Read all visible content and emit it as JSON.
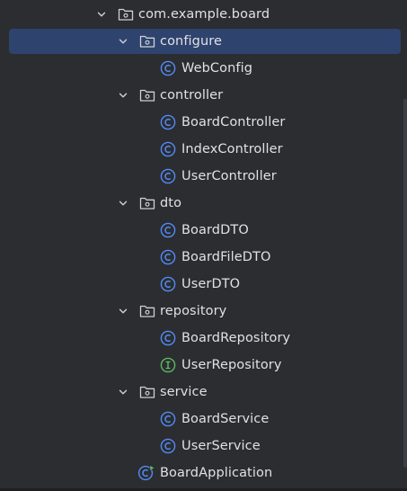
{
  "tree": {
    "root": {
      "label": "com.example.board",
      "icon": "package-folder-icon"
    },
    "configure": {
      "label": "configure",
      "icon": "package-folder-icon"
    },
    "webconfig": {
      "label": "WebConfig",
      "icon": "class-icon"
    },
    "controller": {
      "label": "controller",
      "icon": "package-folder-icon"
    },
    "boardcontroller": {
      "label": "BoardController",
      "icon": "class-icon"
    },
    "indexcontroller": {
      "label": "IndexController",
      "icon": "class-icon"
    },
    "usercontroller": {
      "label": "UserController",
      "icon": "class-icon"
    },
    "dto": {
      "label": "dto",
      "icon": "package-folder-icon"
    },
    "boarddto": {
      "label": "BoardDTO",
      "icon": "class-icon"
    },
    "boardfiledto": {
      "label": "BoardFileDTO",
      "icon": "class-icon"
    },
    "userdto": {
      "label": "UserDTO",
      "icon": "class-icon"
    },
    "repository": {
      "label": "repository",
      "icon": "package-folder-icon"
    },
    "boardrepository": {
      "label": "BoardRepository",
      "icon": "class-icon"
    },
    "userrepository": {
      "label": "UserRepository",
      "icon": "interface-icon"
    },
    "service": {
      "label": "service",
      "icon": "package-folder-icon"
    },
    "boardservice": {
      "label": "BoardService",
      "icon": "class-icon"
    },
    "userservice": {
      "label": "UserService",
      "icon": "class-icon"
    },
    "boardapplication": {
      "label": "BoardApplication",
      "icon": "spring-boot-class-icon"
    }
  },
  "colors": {
    "background": "#2b2d30",
    "selection": "#2e436e",
    "text": "#dfe1e5",
    "class_icon": "#548af7",
    "interface_icon": "#5fb865",
    "spring_icon": "#5fb865"
  }
}
